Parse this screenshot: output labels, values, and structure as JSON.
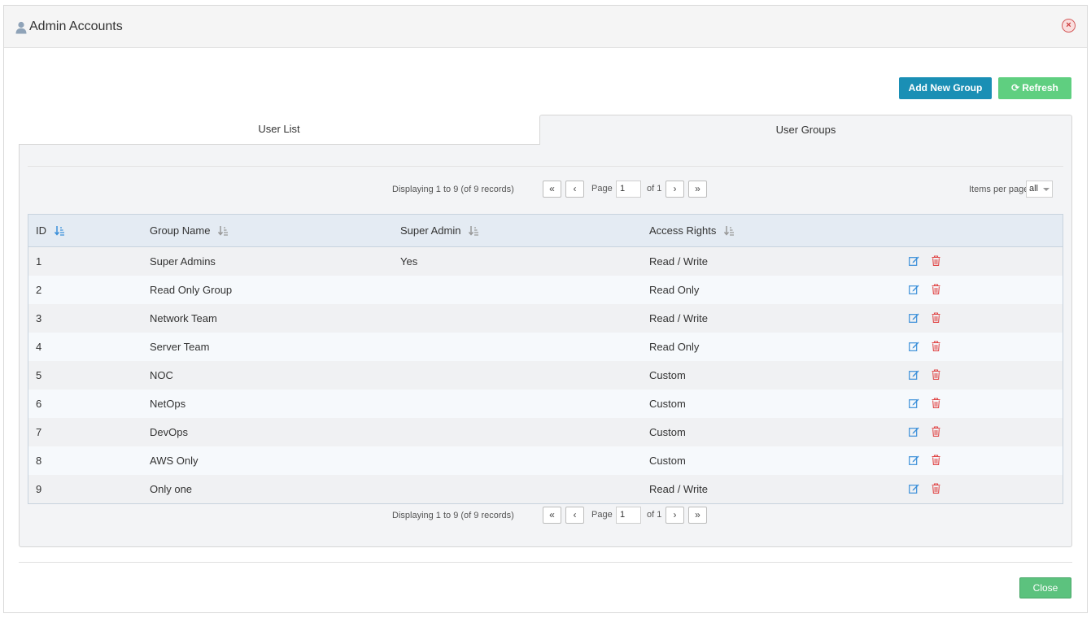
{
  "dialog": {
    "title": "Admin Accounts",
    "title_icon": "user-icon",
    "close_icon": "close-circle-icon"
  },
  "toolbar": {
    "add_group_label": "Add New Group",
    "refresh_label": "Refresh",
    "refresh_icon": "refresh-icon"
  },
  "tabs": [
    {
      "label": "User List",
      "active": false
    },
    {
      "label": "User Groups",
      "active": true
    }
  ],
  "pager": {
    "displaying": "Displaying 1 to 9 (of 9 records)",
    "first": "«",
    "prev": "‹",
    "next": "›",
    "last": "»",
    "page_label": "Page",
    "page_value": "1",
    "of_label": "of 1",
    "items_per_page_label": "Items per page",
    "items_per_page_value": "all"
  },
  "table": {
    "headers": {
      "id": "ID",
      "group_name": "Group Name",
      "super_admin": "Super Admin",
      "access_rights": "Access Rights"
    },
    "rows": [
      {
        "id": "1",
        "name": "Super Admins",
        "super": "Yes",
        "access": "Read / Write"
      },
      {
        "id": "2",
        "name": "Read Only Group",
        "super": "",
        "access": "Read Only"
      },
      {
        "id": "3",
        "name": "Network Team",
        "super": "",
        "access": "Read / Write"
      },
      {
        "id": "4",
        "name": "Server Team",
        "super": "",
        "access": "Read Only"
      },
      {
        "id": "5",
        "name": "NOC",
        "super": "",
        "access": "Custom"
      },
      {
        "id": "6",
        "name": "NetOps",
        "super": "",
        "access": "Custom"
      },
      {
        "id": "7",
        "name": "DevOps",
        "super": "",
        "access": "Custom"
      },
      {
        "id": "8",
        "name": "AWS Only",
        "super": "",
        "access": "Custom"
      },
      {
        "id": "9",
        "name": "Only one",
        "super": "",
        "access": "Read / Write"
      }
    ]
  },
  "footer": {
    "close_label": "Close"
  },
  "colors": {
    "add_button": "#1a8fb5",
    "refresh_button": "#5fcf80",
    "close_button": "#5cc27e",
    "edit_icon": "#3b8fd9",
    "delete_icon": "#e04848"
  }
}
